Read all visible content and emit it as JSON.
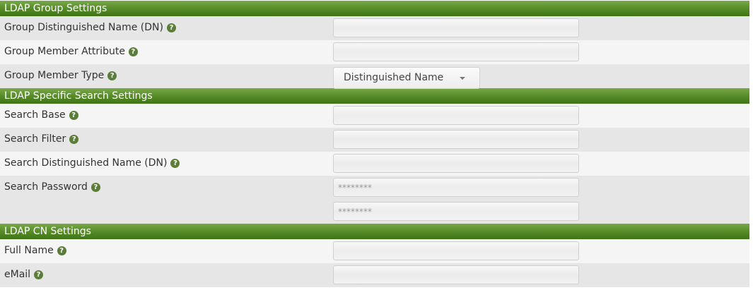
{
  "sections": {
    "group": {
      "title": "LDAP Group Settings",
      "group_dn": {
        "label": "Group Distinguished Name (DN)",
        "value": ""
      },
      "member_attribute": {
        "label": "Group Member Attribute",
        "value": ""
      },
      "member_type": {
        "label": "Group Member Type",
        "selected": "Distinguished Name"
      }
    },
    "search": {
      "title": "LDAP Specific Search Settings",
      "base": {
        "label": "Search Base",
        "value": ""
      },
      "filter": {
        "label": "Search Filter",
        "value": ""
      },
      "dn": {
        "label": "Search Distinguished Name (DN)",
        "value": ""
      },
      "password": {
        "label": "Search Password",
        "value": "********",
        "confirm_value": "********"
      }
    },
    "cn": {
      "title": "LDAP CN Settings",
      "full_name": {
        "label": "Full Name",
        "value": ""
      },
      "email": {
        "label": "eMail",
        "value": ""
      }
    }
  },
  "help_glyph": "?",
  "icons": {
    "help": "question-circle-icon",
    "dropdown": "caret-down-icon"
  },
  "colors": {
    "header_green": "#5a8f2a",
    "help_icon": "#5b7d3a",
    "row_dark": "#e6e6e6",
    "row_light": "#f4f5f4"
  }
}
